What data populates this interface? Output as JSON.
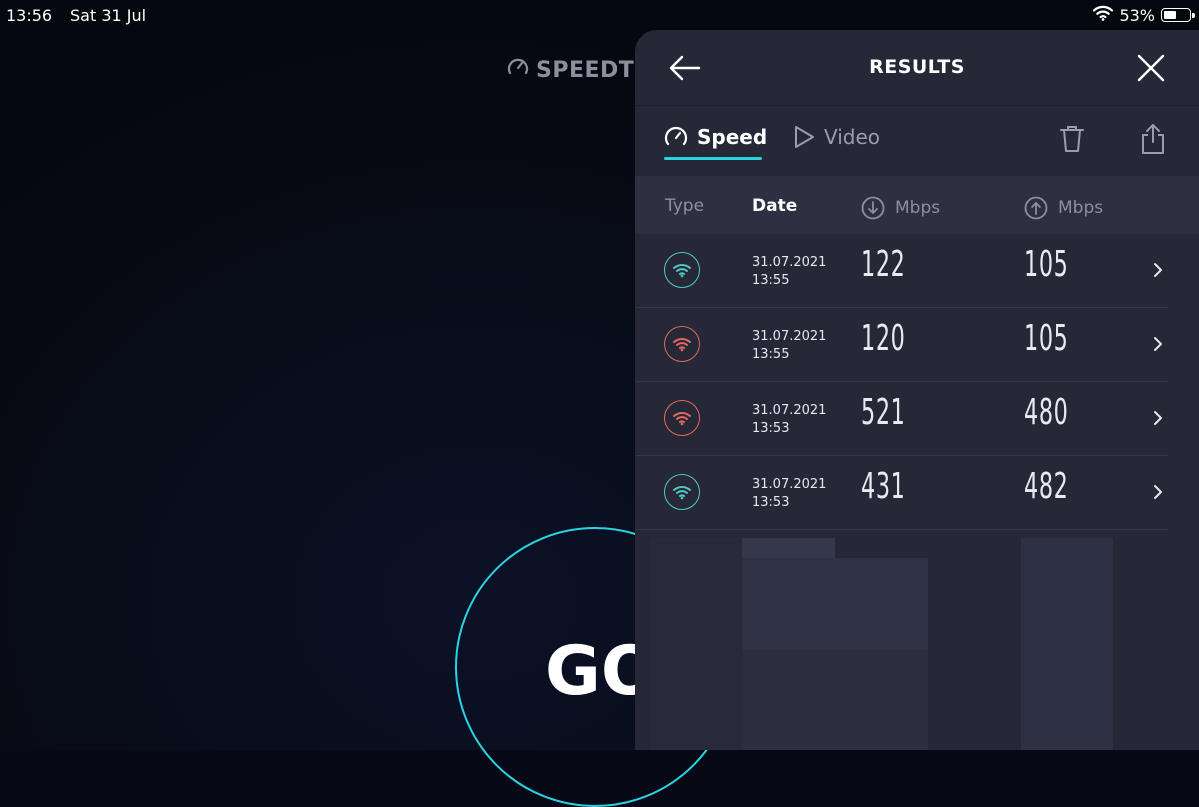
{
  "status_bar": {
    "time": "13:56",
    "date": "Sat 31 Jul",
    "battery": "53%",
    "battery_level": 0.53
  },
  "background": {
    "brand_partial": "SPEEDT",
    "go_label": "GO"
  },
  "panel": {
    "title": "RESULTS",
    "tabs": [
      {
        "label": "Speed",
        "icon": "gauge-icon",
        "active": true
      },
      {
        "label": "Video",
        "icon": "play-icon",
        "active": false
      }
    ],
    "actions": [
      "trash-icon",
      "share-icon"
    ],
    "columns": {
      "type": "Type",
      "date": "Date",
      "download": "Mbps",
      "upload": "Mbps"
    },
    "results": [
      {
        "status": "teal",
        "date": "31.07.2021",
        "time": "13:55",
        "download": "122",
        "upload": "105"
      },
      {
        "status": "red",
        "date": "31.07.2021",
        "time": "13:55",
        "download": "120",
        "upload": "105"
      },
      {
        "status": "red",
        "date": "31.07.2021",
        "time": "13:53",
        "download": "521",
        "upload": "480"
      },
      {
        "status": "teal",
        "date": "31.07.2021",
        "time": "13:53",
        "download": "431",
        "upload": "482"
      }
    ]
  },
  "colors": {
    "accent": "#2ad3e0",
    "teal": "#4fc8c4",
    "red": "#e4685a",
    "panel": "#262838"
  }
}
